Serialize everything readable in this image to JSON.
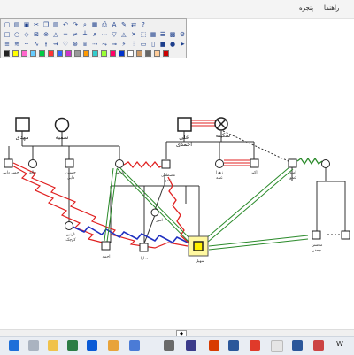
{
  "menubar": {
    "items": [
      "پنجره",
      "راهنما"
    ]
  },
  "people": {
    "mehdi": "مهدی",
    "samira": "سمیه",
    "ali": "علی",
    "ahmadi": "احمدی",
    "sakineh": "سکینه",
    "hamid": "حمید دایی",
    "naser": "ناصر",
    "khaleh": "خاله",
    "hossein": "حسین",
    "dayi": "دایی",
    "nazanin": "نازنین",
    "kochak": "کوچک",
    "mostafa": "مصطفی",
    "amo": "عمو",
    "zahra": "زهرا",
    "ameh": "عمه",
    "akbar": "اکبر",
    "amir": "امیر",
    "ahmad": "احمد",
    "sara": "سارا",
    "soheil": "سهیل",
    "omid": "امید",
    "mohsen": "محسن",
    "jafar": "جعفر"
  },
  "taskbar": {
    "right_label": "W"
  },
  "scrollbar": {
    "thumb_label": "◆"
  }
}
